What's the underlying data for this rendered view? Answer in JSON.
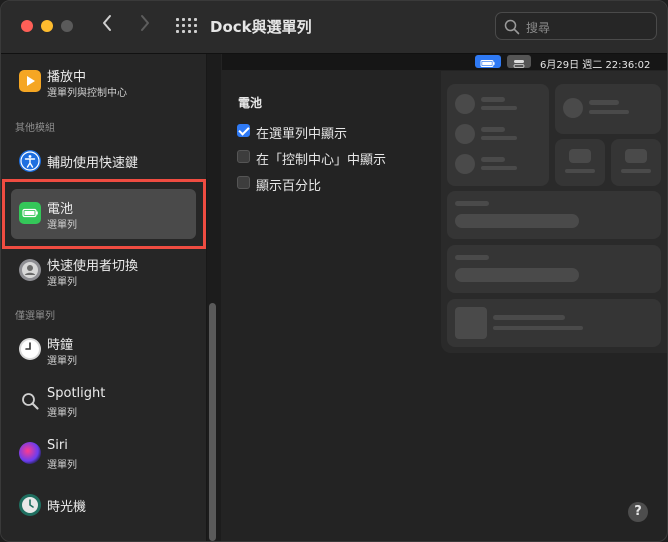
{
  "window": {
    "title": "Dock與選單列"
  },
  "search": {
    "placeholder": "搜尋"
  },
  "menubar": {
    "clock": "6月29日 週二  22:36:02"
  },
  "sidebar": {
    "now_playing": {
      "title": "播放中",
      "subtitle": "選單列與控制中心"
    },
    "section_other": "其他模組",
    "accessibility": {
      "title": "輔助使用快速鍵"
    },
    "battery": {
      "title": "電池",
      "subtitle": "選單列"
    },
    "fast_user": {
      "title": "快速使用者切換",
      "subtitle": "選單列"
    },
    "section_menu_only": "僅選單列",
    "clock": {
      "title": "時鐘",
      "subtitle": "選單列"
    },
    "spotlight": {
      "title": "Spotlight",
      "subtitle": "選單列"
    },
    "siri": {
      "title": "Siri",
      "subtitle": "選單列"
    },
    "time_machine": {
      "title": "時光機"
    }
  },
  "content": {
    "title": "電池",
    "options": [
      {
        "label": "在選單列中顯示",
        "checked": true
      },
      {
        "label": "在「控制中心」中顯示",
        "checked": false
      },
      {
        "label": "顯示百分比",
        "checked": false
      }
    ]
  },
  "help": {
    "label": "?"
  },
  "colors": {
    "accent": "#2f7af5",
    "highlight": "#ef4c41"
  }
}
